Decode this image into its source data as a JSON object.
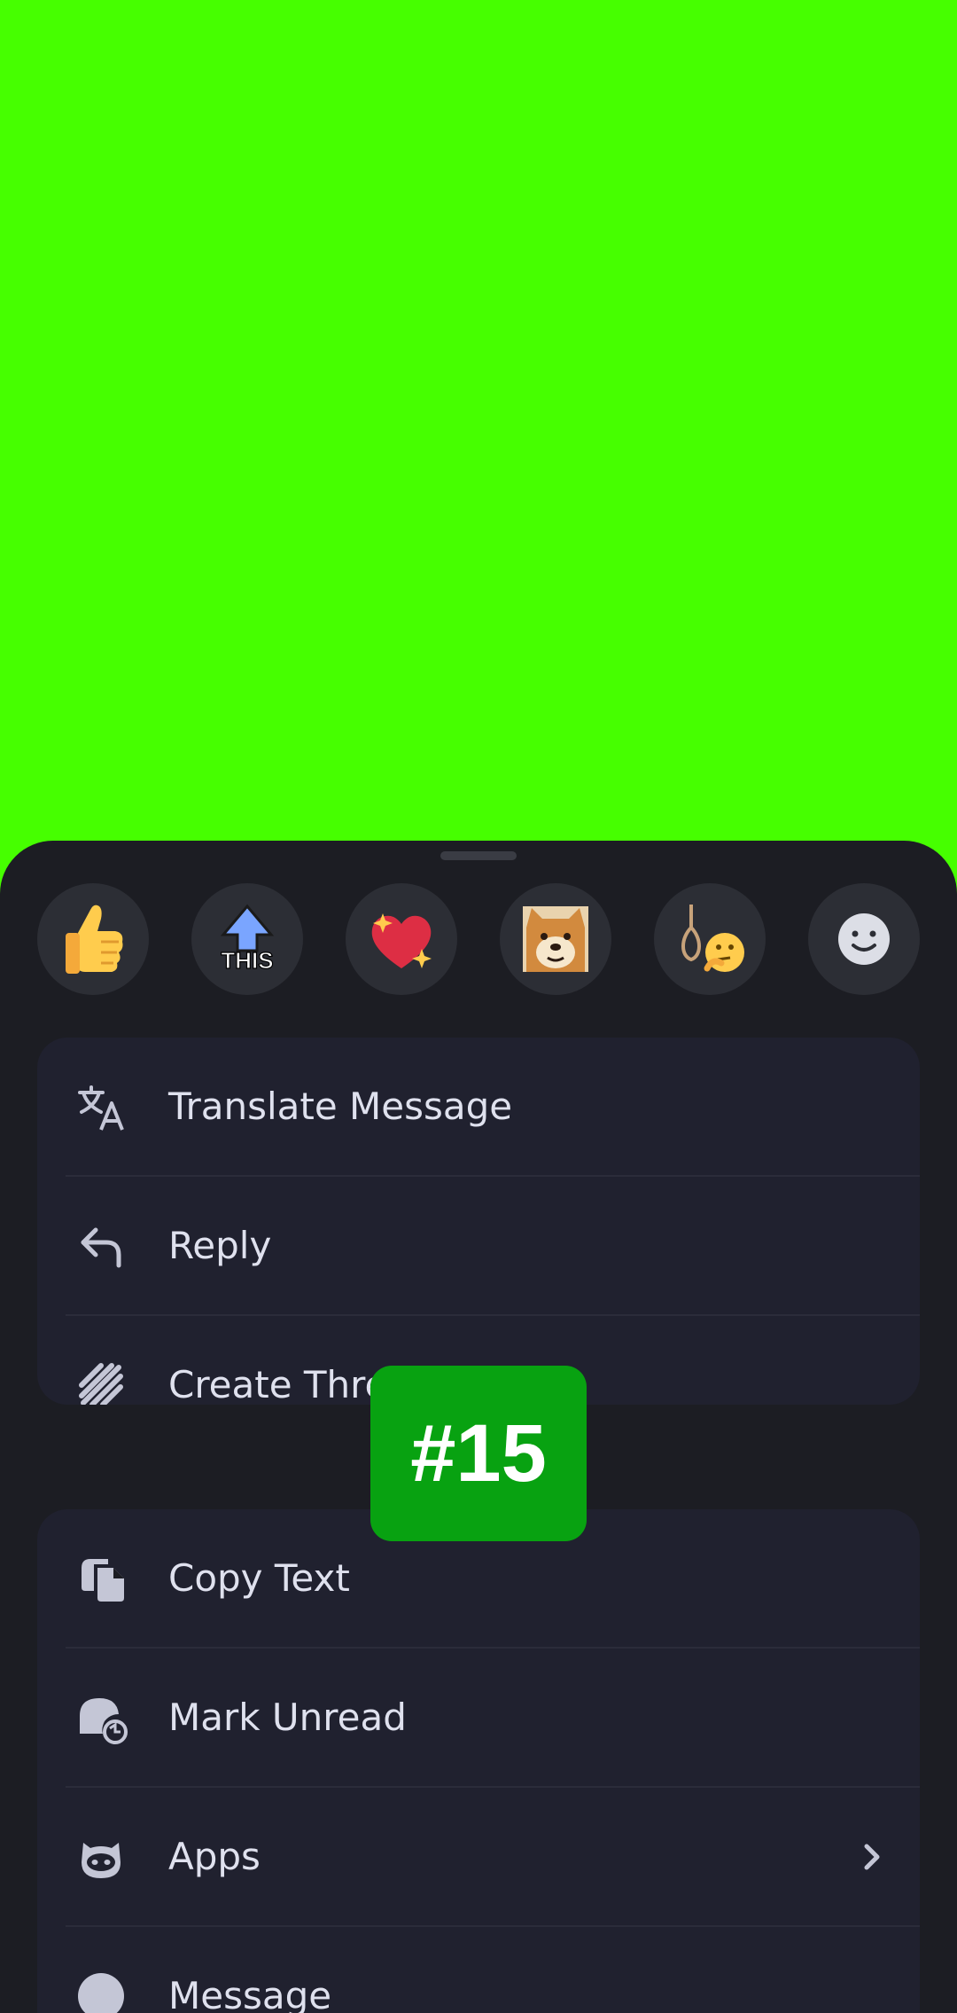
{
  "reactions": [
    {
      "icon": "thumbs-up-icon"
    },
    {
      "icon": "this-arrow-icon",
      "text": "THIS"
    },
    {
      "icon": "sparkling-heart-icon"
    },
    {
      "icon": "doge-icon"
    },
    {
      "icon": "noose-thinking-icon"
    },
    {
      "icon": "add-reaction-icon"
    }
  ],
  "menu_top": [
    {
      "icon": "translate-icon",
      "label": "Translate Message"
    },
    {
      "icon": "reply-icon",
      "label": "Reply"
    },
    {
      "icon": "thread-icon",
      "label": "Create Thread"
    }
  ],
  "menu_bottom": [
    {
      "icon": "copy-text-icon",
      "label": "Copy Text"
    },
    {
      "icon": "mark-unread-icon",
      "label": "Mark Unread"
    },
    {
      "icon": "apps-icon",
      "label": "Apps"
    },
    {
      "icon": "message-icon",
      "label": "Message"
    }
  ],
  "badge": {
    "text": "#15"
  },
  "colors": {
    "backdrop": "#46ff00",
    "sheet": "#1c1d23",
    "card": "#20212f",
    "text": "#dfe1ee",
    "badge": "#08a211"
  }
}
